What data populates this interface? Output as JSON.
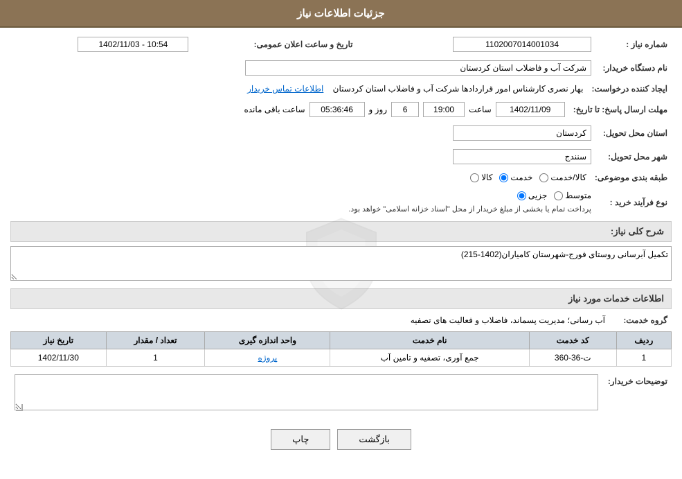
{
  "header": {
    "title": "جزئیات اطلاعات نیاز"
  },
  "form": {
    "need_number_label": "شماره نیاز :",
    "need_number_value": "1102007014001034",
    "announce_date_label": "تاریخ و ساعت اعلان عمومی:",
    "announce_date_value": "1402/11/03 - 10:54",
    "buyer_name_label": "نام دستگاه خریدار:",
    "buyer_name_value": "شرکت آب و فاضلاب استان کردستان",
    "creator_label": "ایجاد کننده درخواست:",
    "creator_value": "بهار نصری کارشناس امور قراردادها شرکت آب و فاضلاب استان کردستان",
    "contact_link": "اطلاعات تماس خریدار",
    "deadline_label": "مهلت ارسال پاسخ: تا تاریخ:",
    "deadline_date": "1402/11/09",
    "deadline_time_label": "ساعت",
    "deadline_time": "19:00",
    "deadline_days_label": "روز و",
    "deadline_days": "6",
    "deadline_remaining_label": "ساعت باقی مانده",
    "deadline_remaining": "05:36:46",
    "province_label": "استان محل تحویل:",
    "province_value": "کردستان",
    "city_label": "شهر محل تحویل:",
    "city_value": "سنندج",
    "category_label": "طبقه بندی موضوعی:",
    "category_kala": "کالا",
    "category_khadamat": "خدمت",
    "category_kala_khadamat": "کالا/خدمت",
    "category_selected": "khadamat",
    "process_label": "نوع فرآیند خرید :",
    "process_jozvi": "جزیی",
    "process_motavasset": "متوسط",
    "process_note": "پرداخت تمام یا بخشی از مبلغ خریدار از محل \"اسناد خزانه اسلامی\" خواهد بود.",
    "need_description_label": "شرح کلی نیاز:",
    "need_description_value": "تکمیل آبرسانی روستای فورج-شهرستان کامیاران(1402-215)",
    "services_section_title": "اطلاعات خدمات مورد نیاز",
    "service_group_label": "گروه خدمت:",
    "service_group_value": "آب رسانی؛ مدیریت پسماند، فاضلاب و فعالیت های تصفیه",
    "table_headers": {
      "row_num": "ردیف",
      "service_code": "کد خدمت",
      "service_name": "نام خدمت",
      "unit": "واحد اندازه گیری",
      "quantity": "تعداد / مقدار",
      "need_date": "تاریخ نیاز"
    },
    "table_rows": [
      {
        "row": "1",
        "code": "ت-36-360",
        "name": "جمع آوری، تصفیه و تامین آب",
        "unit": "پروژه",
        "quantity": "1",
        "date": "1402/11/30"
      }
    ],
    "buyer_notes_label": "توضیحات خریدار:",
    "buyer_notes_value": "",
    "back_button": "بازگشت",
    "print_button": "چاپ"
  }
}
